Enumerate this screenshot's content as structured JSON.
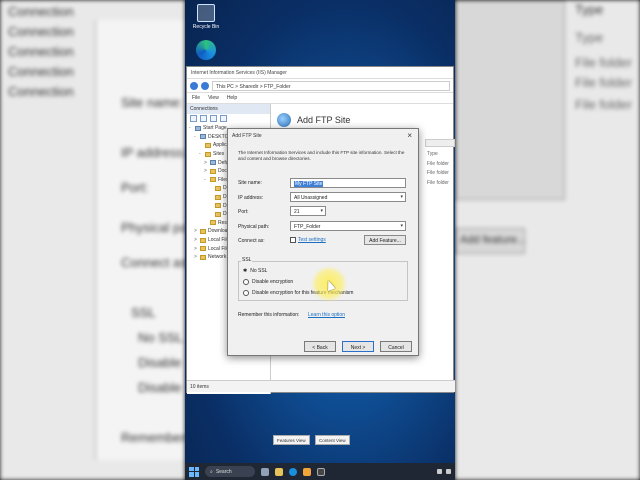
{
  "background_left": {
    "rows": [
      "Connection",
      "Connection",
      "Connection",
      "Connection",
      "Connection"
    ],
    "labels": [
      "Site name:",
      "IP address:",
      "Port:",
      "Physical path:",
      "Connect as:"
    ],
    "ssl_label": "SSL",
    "ssl_no": "No SSL",
    "radios": [
      "Disable",
      "Disable"
    ],
    "footer_label": "Remember this information:",
    "add_feature": "Add feature..."
  },
  "background_right": {
    "header": "Type",
    "items": [
      "Type",
      "File folder",
      "File folder",
      "File folder"
    ]
  },
  "desktop": {
    "recycle_bin_label": "Recycle Bin"
  },
  "iis": {
    "title": "Internet Information Services (IIS) Manager",
    "address": "This PC  >  Sharedir  >  FTP_Folder",
    "menu": [
      "File",
      "View",
      "Help"
    ],
    "connections_header": "Connections",
    "tree": [
      {
        "label": "Start Page",
        "indent": 0,
        "icon": "srv",
        "exp": "-"
      },
      {
        "label": "DESKTOP",
        "indent": 1,
        "icon": "srv",
        "exp": "-"
      },
      {
        "label": "Application Pools",
        "indent": 2,
        "icon": "folder",
        "exp": ""
      },
      {
        "label": "Sites",
        "indent": 2,
        "icon": "folder",
        "exp": "-"
      },
      {
        "label": "Default Web Site",
        "indent": 3,
        "icon": "srv",
        "exp": ">"
      },
      {
        "label": "Docs",
        "indent": 3,
        "icon": "folder",
        "exp": ">"
      },
      {
        "label": "Files",
        "indent": 3,
        "icon": "folder",
        "exp": "-"
      },
      {
        "label": "Data",
        "indent": 4,
        "icon": "folder",
        "exp": ""
      },
      {
        "label": "Data",
        "indent": 4,
        "icon": "folder",
        "exp": ""
      },
      {
        "label": "Data",
        "indent": 4,
        "icon": "folder",
        "exp": ""
      },
      {
        "label": "Data",
        "indent": 4,
        "icon": "folder",
        "exp": ""
      },
      {
        "label": "Resources",
        "indent": 3,
        "icon": "folder",
        "exp": ""
      },
      {
        "label": "Downloads",
        "indent": 1,
        "icon": "folder",
        "exp": ">"
      },
      {
        "label": "Local Files",
        "indent": 1,
        "icon": "folder",
        "exp": ">"
      },
      {
        "label": "Local Files",
        "indent": 1,
        "icon": "folder",
        "exp": ">"
      },
      {
        "label": "Network",
        "indent": 1,
        "icon": "folder",
        "exp": ">"
      }
    ],
    "main_title": "Add FTP Site",
    "type_header": "Type",
    "type_items": [
      "File folder",
      "File folder",
      "File folder"
    ],
    "view_tabs": [
      "Features View",
      "Content View"
    ],
    "status": "Ready",
    "items_count": "10 items"
  },
  "dialog": {
    "title": "Add FTP Site",
    "close_glyph": "×",
    "description": "The Internet Information Services and include this FTP site information. Select the and content and browse directories.",
    "site_name_label": "Site name:",
    "site_name_value": "My FTP Site",
    "ip_label": "IP address:",
    "ip_value": "All Unassigned",
    "port_label": "Port:",
    "port_value": "21",
    "path_label": "Physical path:",
    "path_value": "FTP_Folder",
    "browse_label": "...",
    "connect_label": "Connect as:",
    "connect_link": "Test settings",
    "add_feature_label": "Add Feature...",
    "ssl_legend": "SSL",
    "ssl_options": [
      "No SSL",
      "Disable encryption",
      "Disable encryption for this feature mechanism"
    ],
    "remember_label": "Remember this information:",
    "remember_link": "Learn this option",
    "back_label": "< Back",
    "next_label": "Next >",
    "cancel_label": "Cancel"
  },
  "taskbar": {
    "search_placeholder": "Search"
  }
}
